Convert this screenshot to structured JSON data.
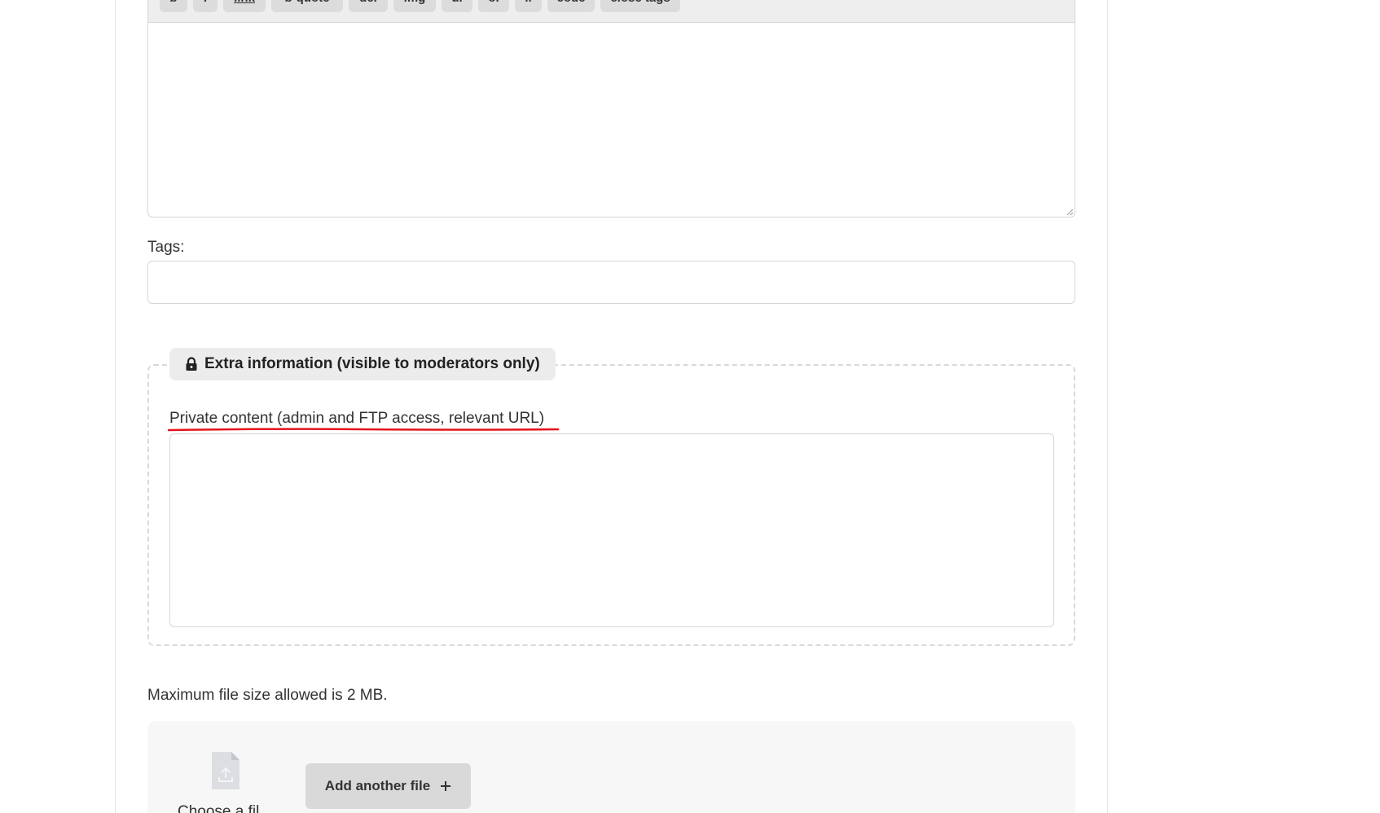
{
  "toolbar": {
    "buttons": [
      "b",
      "i",
      "link",
      "b-quote",
      "del",
      "img",
      "ul",
      "ol",
      "li",
      "code",
      "close tags"
    ]
  },
  "form": {
    "tags_label": "Tags:",
    "tags_value": "",
    "extra_info": {
      "legend": "Extra information (visible to moderators only)",
      "private_label": "Private content (admin and FTP access, relevant URL)",
      "private_value": ""
    },
    "file_size_note": "Maximum file size allowed is 2 MB.",
    "upload": {
      "choose_file_label": "Choose a fil",
      "add_file_label": "Add another file"
    }
  },
  "colors": {
    "annotation": "#e3141b",
    "button_bg": "#d9d9d9",
    "upload_bg": "#f7f7f7"
  },
  "icons": [
    "lock-icon",
    "file-upload-icon",
    "plus-icon",
    "resize-grip-icon"
  ]
}
